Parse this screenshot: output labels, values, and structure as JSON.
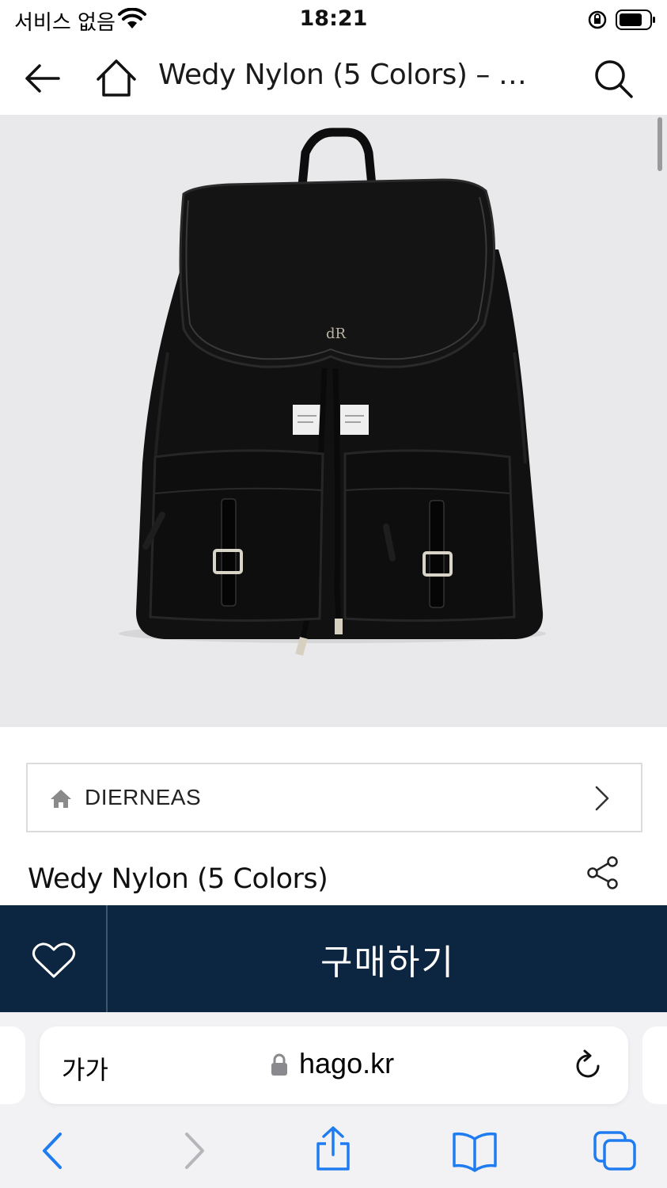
{
  "status_bar": {
    "carrier": "서비스 없음",
    "time": "18:21"
  },
  "nav": {
    "title": "Wedy Nylon (5 Colors) – …"
  },
  "brand": {
    "name": "DIERNEAS"
  },
  "product": {
    "title": "Wedy Nylon (5 Colors)",
    "image_logo_text": "dR"
  },
  "buy_bar": {
    "buy_label": "구매하기"
  },
  "browser": {
    "text_size_label": "가가",
    "url": "hago.kr"
  },
  "colors": {
    "buy_bar_bg": "#0c2540",
    "image_bg": "#e9e9eb",
    "safari_bg": "#f2f2f5",
    "toolbar_accent": "#1f7cf0"
  },
  "icons": {
    "status": [
      "wifi-icon",
      "rotation-lock-icon",
      "battery-icon"
    ],
    "nav": [
      "back-arrow-icon",
      "home-icon",
      "search-icon"
    ],
    "content": [
      "store-home-icon",
      "chevron-right-icon",
      "share-icon",
      "heart-icon"
    ],
    "toolbar": [
      "back-chevron-icon",
      "forward-chevron-icon",
      "share-upload-icon",
      "bookmarks-book-icon",
      "tabs-icon",
      "padlock-icon",
      "reload-icon"
    ]
  }
}
